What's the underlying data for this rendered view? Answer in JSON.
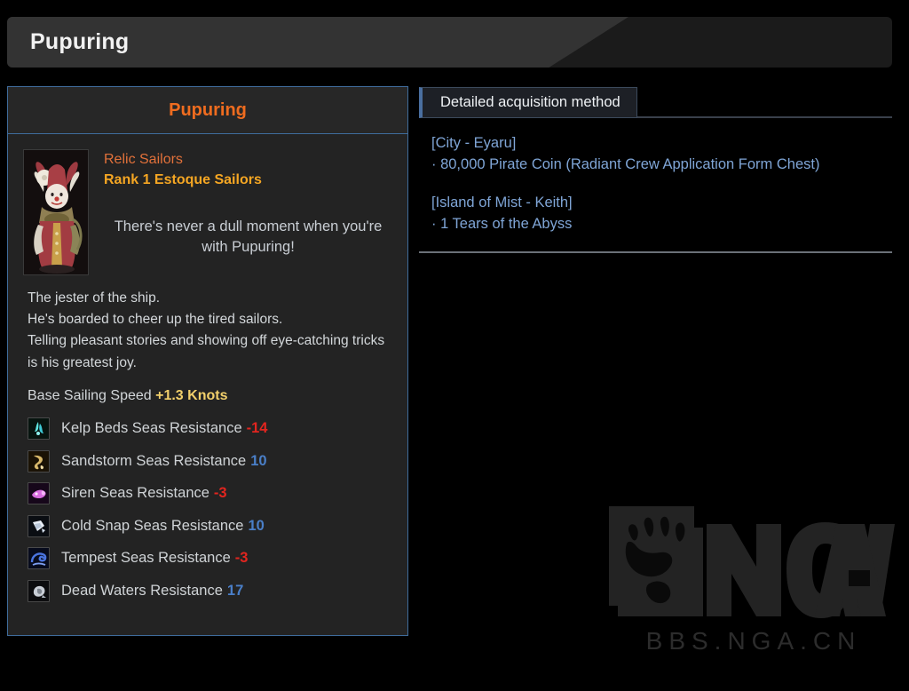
{
  "header": {
    "title": "Pupuring"
  },
  "left_panel": {
    "title": "Pupuring",
    "faction": "Relic Sailors",
    "rank": "Rank 1 Estoque Sailors",
    "flavor": "There's never a dull moment when you're with Pupuring!",
    "description": "The jester of the ship.\nHe's boarded to cheer up the tired sailors.\nTelling pleasant stories and showing off eye-catching tricks is his greatest joy.",
    "speed_label": "Base Sailing Speed",
    "speed_value": "+1.3 Knots",
    "portrait_alt": "jester-character-portrait",
    "resistances": [
      {
        "icon": "kelp-icon",
        "label": "Kelp Beds Seas Resistance",
        "value": "-14",
        "sign": "neg"
      },
      {
        "icon": "sandstorm-icon",
        "label": "Sandstorm Seas Resistance",
        "value": "10",
        "sign": "pos"
      },
      {
        "icon": "siren-icon",
        "label": "Siren Seas Resistance",
        "value": "-3",
        "sign": "neg"
      },
      {
        "icon": "coldsnap-icon",
        "label": "Cold Snap Seas Resistance",
        "value": "10",
        "sign": "pos"
      },
      {
        "icon": "tempest-icon",
        "label": "Tempest Seas Resistance",
        "value": "-3",
        "sign": "neg"
      },
      {
        "icon": "deadwaters-icon",
        "label": "Dead Waters Resistance",
        "value": "17",
        "sign": "pos"
      }
    ]
  },
  "right_panel": {
    "tab_label": "Detailed acquisition method",
    "groups": [
      {
        "location": "[City - Eyaru]",
        "items": [
          "· 80,000 Pirate Coin (Radiant Crew Application Form Chest)"
        ]
      },
      {
        "location": "[Island of Mist - Keith]",
        "items": [
          "· 1 Tears of the Abyss"
        ]
      }
    ]
  },
  "watermark": {
    "text": "BBS.NGA.CN",
    "logo": "nga-bear-paw-logo"
  },
  "colors": {
    "accent_orange": "#ef6c1f",
    "rank_gold": "#f5a623",
    "panel_border_blue": "#3f6c9c",
    "link_blue": "#7fa5d6",
    "value_negative": "#e2251f",
    "value_positive": "#4a7fc8",
    "speed_value": "#f2d06b",
    "background": "#000000"
  }
}
